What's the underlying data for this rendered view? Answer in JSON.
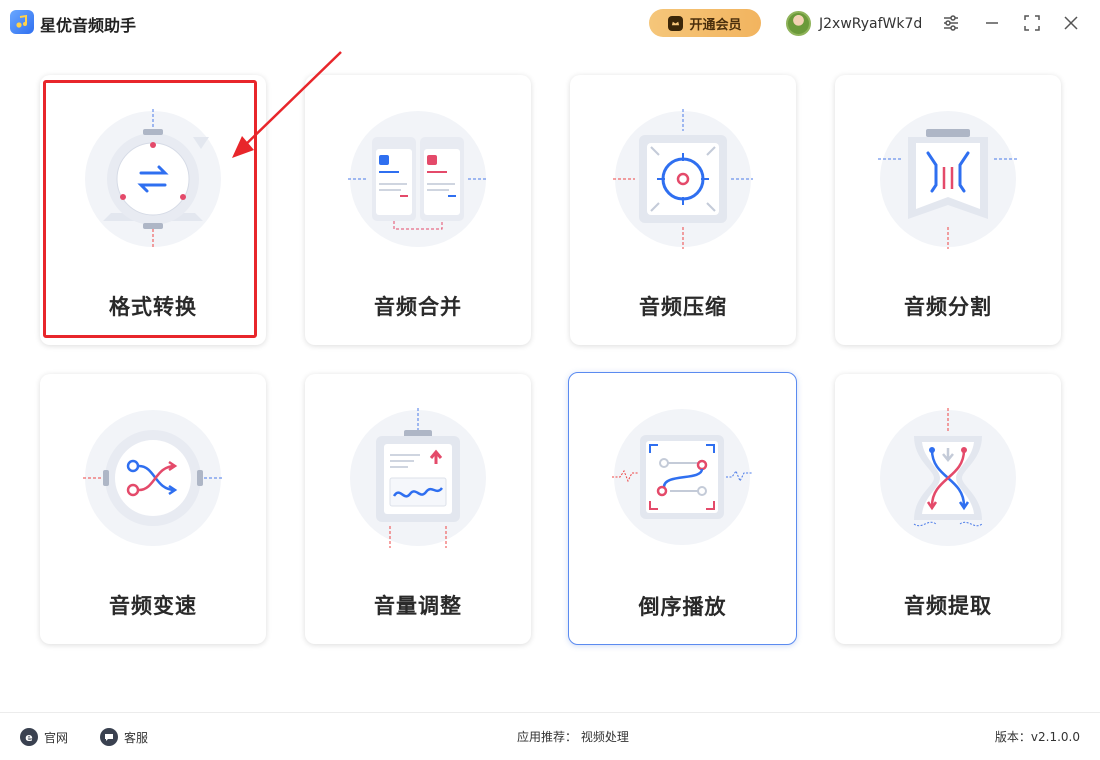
{
  "app": {
    "title": "星优音频助手"
  },
  "header": {
    "vip_label": "开通会员",
    "username": "J2xwRyafWk7d"
  },
  "cards": [
    {
      "label": "格式转换"
    },
    {
      "label": "音频合并"
    },
    {
      "label": "音频压缩"
    },
    {
      "label": "音频分割"
    },
    {
      "label": "音频变速"
    },
    {
      "label": "音量调整"
    },
    {
      "label": "倒序播放"
    },
    {
      "label": "音频提取"
    }
  ],
  "footer": {
    "website_label": "官网",
    "support_label": "客服",
    "recommend_label": "应用推荐：",
    "recommend_link": "视频处理",
    "version_label": "版本：",
    "version_value": "v2.1.0.0"
  },
  "colors": {
    "accent": "#2f6ff0",
    "highlight": "#e8262b",
    "vip": "#f2b45f"
  }
}
